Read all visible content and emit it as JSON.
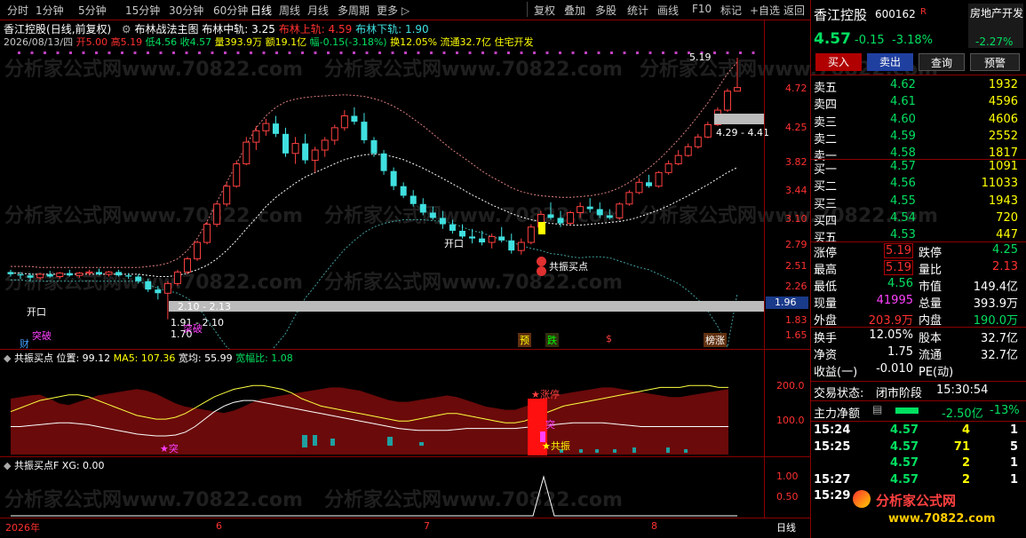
{
  "toolbar": {
    "periods": [
      "分时",
      "1分钟",
      "5分钟",
      "15分钟",
      "30分钟",
      "60分钟",
      "日线",
      "周线",
      "月线",
      "多周期",
      "更多 ▷"
    ],
    "active_period": "日线",
    "right_buttons": [
      "复权",
      "叠加",
      "多股",
      "统计",
      "画线",
      "F10",
      "标记",
      "+自选",
      "返回"
    ]
  },
  "chart_header": {
    "stock": "香江控股",
    "mode": "(日线,前复权)",
    "main_indicator": "布林战法主图",
    "mid_label": "布林中轨: 3.25",
    "upper_label": "布林上轨: 4.59",
    "lower_label": "布林下轨: 1.90",
    "info_date": "2026/08/13/四",
    "info_open": "开5.00",
    "info_high": "高5.19",
    "info_low": "低4.56",
    "info_close": "收4.57",
    "info_vol": "量393.9万",
    "info_amt": "额19.1亿",
    "info_chg": "幅-0.15(-3.18%)",
    "info_turn": "换12.05%",
    "info_float": "流通32.7亿",
    "info_sector": "住宅开发"
  },
  "price_axis": [
    "4.72",
    "4.25",
    "3.82",
    "3.44",
    "3.10",
    "2.79",
    "2.51",
    "2.26",
    "2.03",
    "1.83",
    "1.65"
  ],
  "price_highlight": "1.96",
  "annotations": {
    "peak": "5.19",
    "range_top": "4.29 - 4.41",
    "range_bottom": "2.10 - 2.13",
    "low_a": "1.91 - 2.10",
    "low_b": "1.70",
    "kaikou1": "开口",
    "kaikou2": "开口",
    "tupo1": "突破",
    "tupo2": "突破",
    "cai": "财",
    "gongzhen": "共振买点",
    "tag_yu": "预",
    "tag_die": "跌",
    "tag_s": "$",
    "tag_zhangting": "榜涨"
  },
  "sub1": {
    "title": "共振买点",
    "pos": "位置: 99.12",
    "ma5": "MA5: 107.36",
    "width": "宽均: 55.99",
    "width_ratio": "宽幅比: 1.08",
    "axis": [
      "200.0",
      "100.0"
    ],
    "label_zhangting": "★涨停",
    "label_tu": "突",
    "label_gongzhen": "★共振",
    "label_tu2": "★突"
  },
  "sub2": {
    "title": "共振买点F",
    "xg": "XG: 0.00",
    "axis": [
      "1.00",
      "0.50"
    ]
  },
  "time_axis": {
    "labels": [
      "2026年",
      "6",
      "7",
      "8"
    ],
    "period_label": "日线"
  },
  "quote": {
    "name": "香江控股",
    "code": "600162",
    "flag": "R",
    "sector": "房地产开发",
    "sector_chg": "-2.27%",
    "price": "4.57",
    "chg": "-0.15",
    "pct": "-3.18%",
    "buttons": [
      "买入",
      "卖出",
      "查询",
      "预警"
    ],
    "asks": [
      {
        "label": "卖五",
        "price": "4.62",
        "vol": "1932"
      },
      {
        "label": "卖四",
        "price": "4.61",
        "vol": "4596"
      },
      {
        "label": "卖三",
        "price": "4.60",
        "vol": "4606"
      },
      {
        "label": "卖二",
        "price": "4.59",
        "vol": "2552"
      },
      {
        "label": "卖一",
        "price": "4.58",
        "vol": "1817"
      }
    ],
    "bids": [
      {
        "label": "买一",
        "price": "4.57",
        "vol": "1091"
      },
      {
        "label": "买二",
        "price": "4.56",
        "vol": "11033"
      },
      {
        "label": "买三",
        "price": "4.55",
        "vol": "1943"
      },
      {
        "label": "买四",
        "price": "4.54",
        "vol": "720"
      },
      {
        "label": "买五",
        "price": "4.53",
        "vol": "447"
      }
    ],
    "stats": [
      {
        "l1": "涨停",
        "v1": "5.19",
        "l2": "跌停",
        "v2": "4.25"
      },
      {
        "l1": "最高",
        "v1": "5.19",
        "l2": "量比",
        "v2": "2.13"
      },
      {
        "l1": "最低",
        "v1": "4.56",
        "l2": "市值",
        "v2": "149.4亿"
      },
      {
        "l1": "现量",
        "v1": "41995",
        "l2": "总量",
        "v2": "393.9万"
      },
      {
        "l1": "外盘",
        "v1": "203.9万",
        "l2": "内盘",
        "v2": "190.0万"
      }
    ],
    "stats2": [
      {
        "l1": "换手",
        "v1": "12.05%",
        "l2": "股本",
        "v2": "32.7亿"
      },
      {
        "l1": "净资",
        "v1": "1.75",
        "l2": "流通",
        "v2": "32.7亿"
      },
      {
        "l1": "收益(一)",
        "v1": "-0.010",
        "l2": "PE(动)",
        "v2": ""
      }
    ],
    "trade_status_label": "交易状态:",
    "trade_status": "闭市阶段",
    "trade_time": "15:30:54",
    "main_flow_label": "主力净额",
    "main_flow": "-2.50亿",
    "main_flow_pct": "-13%",
    "ticks": [
      {
        "t": "15:24",
        "p": "4.57",
        "v": "4",
        "n": "1"
      },
      {
        "t": "15:25",
        "p": "4.57",
        "v": "71",
        "n": "5"
      },
      {
        "t": "",
        "p": "4.57",
        "v": "2",
        "n": "1"
      },
      {
        "t": "15:27",
        "p": "4.57",
        "v": "2",
        "n": "1"
      },
      {
        "t": "15:29",
        "p": "",
        "v": "",
        "n": ""
      }
    ],
    "logo": "分析家公式网",
    "logo_url": "www.70822.com"
  },
  "watermark": "分析家公式网www.70822.com",
  "chart_data": {
    "type": "candlestick",
    "candles": [
      [
        2.08,
        2.1,
        2.04,
        2.06
      ],
      [
        2.06,
        2.08,
        2.02,
        2.05
      ],
      [
        2.05,
        2.07,
        2.0,
        2.03
      ],
      [
        2.03,
        2.07,
        2.01,
        2.06
      ],
      [
        2.06,
        2.09,
        2.03,
        2.04
      ],
      [
        2.04,
        2.08,
        2.02,
        2.07
      ],
      [
        2.07,
        2.1,
        2.04,
        2.05
      ],
      [
        2.05,
        2.08,
        2.03,
        2.07
      ],
      [
        2.07,
        2.1,
        2.05,
        2.08
      ],
      [
        2.08,
        2.11,
        2.05,
        2.06
      ],
      [
        2.06,
        2.09,
        2.04,
        2.08
      ],
      [
        2.08,
        2.1,
        2.04,
        2.05
      ],
      [
        2.05,
        2.07,
        2.02,
        2.04
      ],
      [
        2.04,
        2.06,
        1.98,
        2.0
      ],
      [
        2.0,
        2.02,
        1.91,
        1.93
      ],
      [
        1.93,
        1.96,
        1.85,
        1.9
      ],
      [
        1.9,
        2.0,
        1.7,
        1.98
      ],
      [
        1.98,
        2.1,
        1.96,
        2.08
      ],
      [
        2.08,
        2.22,
        2.06,
        2.2
      ],
      [
        2.2,
        2.38,
        2.18,
        2.36
      ],
      [
        2.36,
        2.58,
        2.34,
        2.55
      ],
      [
        2.55,
        2.8,
        2.52,
        2.78
      ],
      [
        2.78,
        3.05,
        2.75,
        3.0
      ],
      [
        3.0,
        3.35,
        2.98,
        3.3
      ],
      [
        3.3,
        3.7,
        3.28,
        3.62
      ],
      [
        3.62,
        3.88,
        3.5,
        3.8
      ],
      [
        3.8,
        4.0,
        3.72,
        3.92
      ],
      [
        3.92,
        4.05,
        3.7,
        3.75
      ],
      [
        3.75,
        3.85,
        3.4,
        3.45
      ],
      [
        3.45,
        3.7,
        3.3,
        3.6
      ],
      [
        3.6,
        3.75,
        3.3,
        3.35
      ],
      [
        3.35,
        3.55,
        3.18,
        3.5
      ],
      [
        3.5,
        3.7,
        3.4,
        3.65
      ],
      [
        3.65,
        3.9,
        3.58,
        3.85
      ],
      [
        3.85,
        4.15,
        3.8,
        4.05
      ],
      [
        4.05,
        4.2,
        3.9,
        3.95
      ],
      [
        3.95,
        4.1,
        3.6,
        3.65
      ],
      [
        3.65,
        3.7,
        3.4,
        3.45
      ],
      [
        3.45,
        3.5,
        3.15,
        3.2
      ],
      [
        3.2,
        3.25,
        2.95,
        3.0
      ],
      [
        3.0,
        3.05,
        2.85,
        2.88
      ],
      [
        2.88,
        2.95,
        2.75,
        2.78
      ],
      [
        2.78,
        2.85,
        2.65,
        2.68
      ],
      [
        2.68,
        2.75,
        2.6,
        2.62
      ],
      [
        2.62,
        2.7,
        2.5,
        2.55
      ],
      [
        2.55,
        2.6,
        2.45,
        2.48
      ],
      [
        2.48,
        2.55,
        2.4,
        2.42
      ],
      [
        2.42,
        2.5,
        2.35,
        2.4
      ],
      [
        2.4,
        2.48,
        2.33,
        2.36
      ],
      [
        2.36,
        2.45,
        2.3,
        2.42
      ],
      [
        2.42,
        2.52,
        2.36,
        2.38
      ],
      [
        2.38,
        2.45,
        2.25,
        2.28
      ],
      [
        2.28,
        2.4,
        2.24,
        2.36
      ],
      [
        2.36,
        2.55,
        2.34,
        2.52
      ],
      [
        2.52,
        2.7,
        2.5,
        2.66
      ],
      [
        2.66,
        2.8,
        2.6,
        2.62
      ],
      [
        2.62,
        2.7,
        2.52,
        2.56
      ],
      [
        2.56,
        2.7,
        2.54,
        2.68
      ],
      [
        2.68,
        2.8,
        2.62,
        2.75
      ],
      [
        2.75,
        2.85,
        2.68,
        2.72
      ],
      [
        2.72,
        2.8,
        2.62,
        2.65
      ],
      [
        2.65,
        2.72,
        2.6,
        2.62
      ],
      [
        2.62,
        2.8,
        2.6,
        2.78
      ],
      [
        2.78,
        2.95,
        2.76,
        2.92
      ],
      [
        2.92,
        3.1,
        2.9,
        3.05
      ],
      [
        3.05,
        3.15,
        2.98,
        3.0
      ],
      [
        3.0,
        3.2,
        2.98,
        3.18
      ],
      [
        3.18,
        3.35,
        3.15,
        3.3
      ],
      [
        3.3,
        3.5,
        3.28,
        3.42
      ],
      [
        3.42,
        3.6,
        3.4,
        3.55
      ],
      [
        3.55,
        3.75,
        3.52,
        3.7
      ],
      [
        3.7,
        3.95,
        3.68,
        3.9
      ],
      [
        3.9,
        4.2,
        3.88,
        4.15
      ],
      [
        4.15,
        4.55,
        4.12,
        4.5
      ],
      [
        4.5,
        5.19,
        4.56,
        4.57
      ]
    ],
    "upper": [
      2.13,
      2.13,
      2.13,
      2.12,
      2.12,
      2.12,
      2.12,
      2.12,
      2.12,
      2.12,
      2.12,
      2.12,
      2.12,
      2.12,
      2.13,
      2.14,
      2.16,
      2.2,
      2.28,
      2.4,
      2.58,
      2.8,
      3.05,
      3.3,
      3.58,
      3.85,
      4.05,
      4.2,
      4.3,
      4.35,
      4.38,
      4.4,
      4.41,
      4.42,
      4.43,
      4.42,
      4.4,
      4.36,
      4.3,
      4.22,
      4.12,
      4.0,
      3.88,
      3.75,
      3.62,
      3.5,
      3.4,
      3.3,
      3.2,
      3.12,
      3.05,
      2.98,
      2.93,
      2.9,
      2.88,
      2.87,
      2.86,
      2.86,
      2.87,
      2.88,
      2.9,
      2.93,
      2.98,
      3.05,
      3.14,
      3.24,
      3.36,
      3.5,
      3.66,
      3.84,
      4.05,
      4.28,
      4.55,
      4.85,
      5.1
    ],
    "mid": [
      2.07,
      2.07,
      2.06,
      2.06,
      2.06,
      2.06,
      2.06,
      2.06,
      2.06,
      2.06,
      2.06,
      2.06,
      2.06,
      2.06,
      2.05,
      2.04,
      2.04,
      2.05,
      2.07,
      2.1,
      2.14,
      2.2,
      2.28,
      2.38,
      2.5,
      2.62,
      2.75,
      2.86,
      2.95,
      3.04,
      3.12,
      3.18,
      3.24,
      3.3,
      3.36,
      3.4,
      3.43,
      3.44,
      3.43,
      3.4,
      3.36,
      3.3,
      3.24,
      3.17,
      3.1,
      3.03,
      2.96,
      2.89,
      2.83,
      2.77,
      2.72,
      2.67,
      2.63,
      2.6,
      2.58,
      2.56,
      2.55,
      2.54,
      2.54,
      2.55,
      2.56,
      2.57,
      2.58,
      2.6,
      2.63,
      2.67,
      2.71,
      2.76,
      2.82,
      2.88,
      2.95,
      3.02,
      3.1,
      3.18,
      3.25
    ],
    "lower": [
      2.01,
      2.01,
      2.0,
      2.0,
      2.0,
      2.0,
      2.0,
      2.0,
      2.0,
      2.0,
      2.0,
      2.0,
      2.0,
      2.0,
      1.97,
      1.94,
      1.92,
      1.9,
      1.86,
      1.8,
      1.7,
      1.6,
      1.51,
      1.46,
      1.42,
      1.4,
      1.45,
      1.52,
      1.6,
      1.73,
      1.86,
      1.96,
      2.07,
      2.18,
      2.29,
      2.38,
      2.46,
      2.52,
      2.56,
      2.58,
      2.6,
      2.6,
      2.6,
      2.59,
      2.58,
      2.56,
      2.52,
      2.48,
      2.46,
      2.42,
      2.39,
      2.36,
      2.33,
      2.3,
      2.28,
      2.25,
      2.24,
      2.22,
      2.21,
      2.22,
      2.22,
      2.21,
      2.18,
      2.15,
      2.12,
      2.1,
      2.06,
      2.02,
      1.98,
      1.92,
      1.85,
      1.76,
      1.65,
      1.51,
      1.9
    ]
  }
}
